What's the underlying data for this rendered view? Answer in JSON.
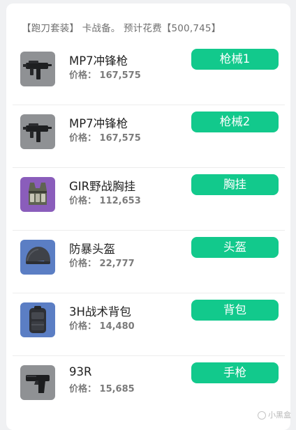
{
  "summary": {
    "text": "【跑刀套装】 卡战备。 预计花费【500,745】"
  },
  "items": [
    {
      "name": "MP7冲锋枪",
      "price": "价格：  167,575",
      "slot": "枪械1",
      "icon": "smg-icon"
    },
    {
      "name": "MP7冲锋枪",
      "price": "价格：  167,575",
      "slot": "枪械2",
      "icon": "smg-icon"
    },
    {
      "name": "GIR野战胸挂",
      "price": "价格：  112,653",
      "slot": "胸挂",
      "icon": "chest-rig-icon"
    },
    {
      "name": "防暴头盔",
      "price": "价格：  22,777",
      "slot": "头盔",
      "icon": "helmet-icon"
    },
    {
      "name": "3H战术背包",
      "price": "价格：  14,480",
      "slot": "背包",
      "icon": "backpack-icon"
    },
    {
      "name": "93R",
      "price": "价格：  15,685",
      "slot": "手枪",
      "icon": "pistol-icon"
    }
  ],
  "colors": {
    "accent": "#12c98c",
    "background": "#f0f1f3",
    "card": "#ffffff",
    "thumb_gray": "#8f9194",
    "thumb_purple": "#8a5dbb",
    "thumb_blue": "#5b7ec4"
  },
  "watermark": {
    "text": "小黑盒"
  }
}
